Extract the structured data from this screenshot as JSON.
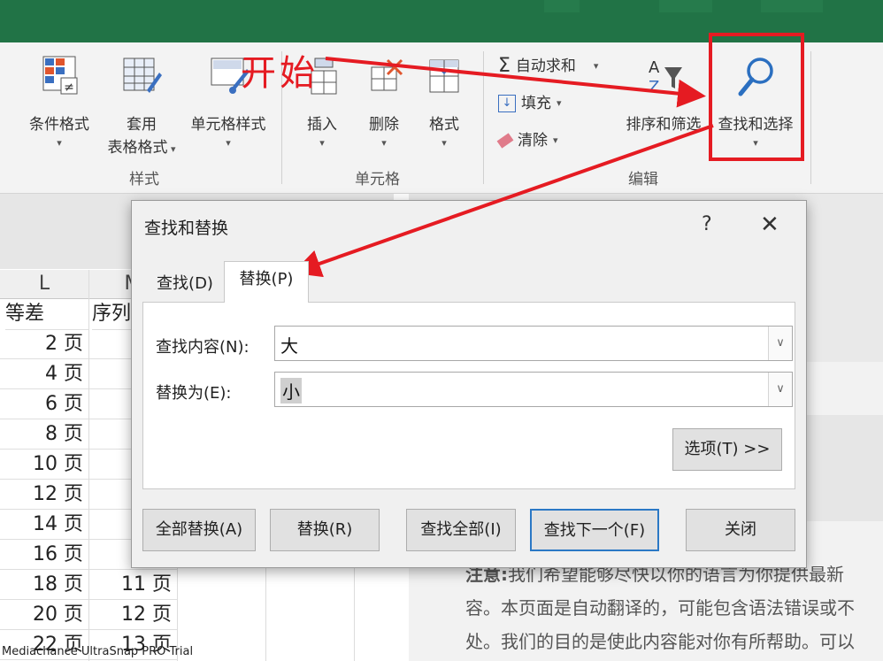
{
  "ribbon": {
    "buttons": {
      "conditional_format": "条件格式",
      "table_format_1": "套用",
      "table_format_2": "表格格式",
      "cell_style": "单元格样式",
      "insert": "插入",
      "delete": "删除",
      "format": "格式",
      "autosum": "自动求和",
      "fill": "填充",
      "clear": "清除",
      "sort_filter": "排序和筛选",
      "find_select": "查找和选择"
    },
    "groups": {
      "styles": "样式",
      "cells": "单元格",
      "editing": "编辑"
    }
  },
  "sheet": {
    "columns": [
      "L",
      "M"
    ],
    "headers": [
      "等差",
      "序列"
    ],
    "col_l": [
      "2 页",
      "4 页",
      "6 页",
      "8 页",
      "10 页",
      "12 页",
      "14 页",
      "16 页",
      "18 页",
      "20 页",
      "22 页"
    ],
    "col_m": [
      "",
      "",
      "",
      "",
      "",
      "",
      "",
      "",
      "11 页",
      "12 页",
      "13 页"
    ]
  },
  "dialog": {
    "title": "查找和替换",
    "help": "?",
    "close": "✕",
    "tabs": {
      "find": "查找(D)",
      "replace": "替换(P)"
    },
    "find_label": "查找内容(N):",
    "find_value": "大",
    "replace_label": "替换为(E):",
    "replace_value": "小",
    "options_button": "选项(T) >>",
    "buttons": {
      "replace_all": "全部替换(A)",
      "replace": "替换(R)",
      "find_all": "查找全部(I)",
      "find_next": "查找下一个(F)",
      "close": "关闭"
    }
  },
  "help_pane": {
    "line1_bold": "注意:",
    "line1": "我们希望能够尽快以你的语言为你提供最新",
    "line2": "容。本页面是自动翻译的，可能包含语法错误或不",
    "line3": "处。我们的目的是使此内容能对你有所帮助。可以"
  },
  "annotation": {
    "start": "开始",
    "color": "#e51b22"
  },
  "watermark": "Mediachance UltraSnap PRO Trial"
}
